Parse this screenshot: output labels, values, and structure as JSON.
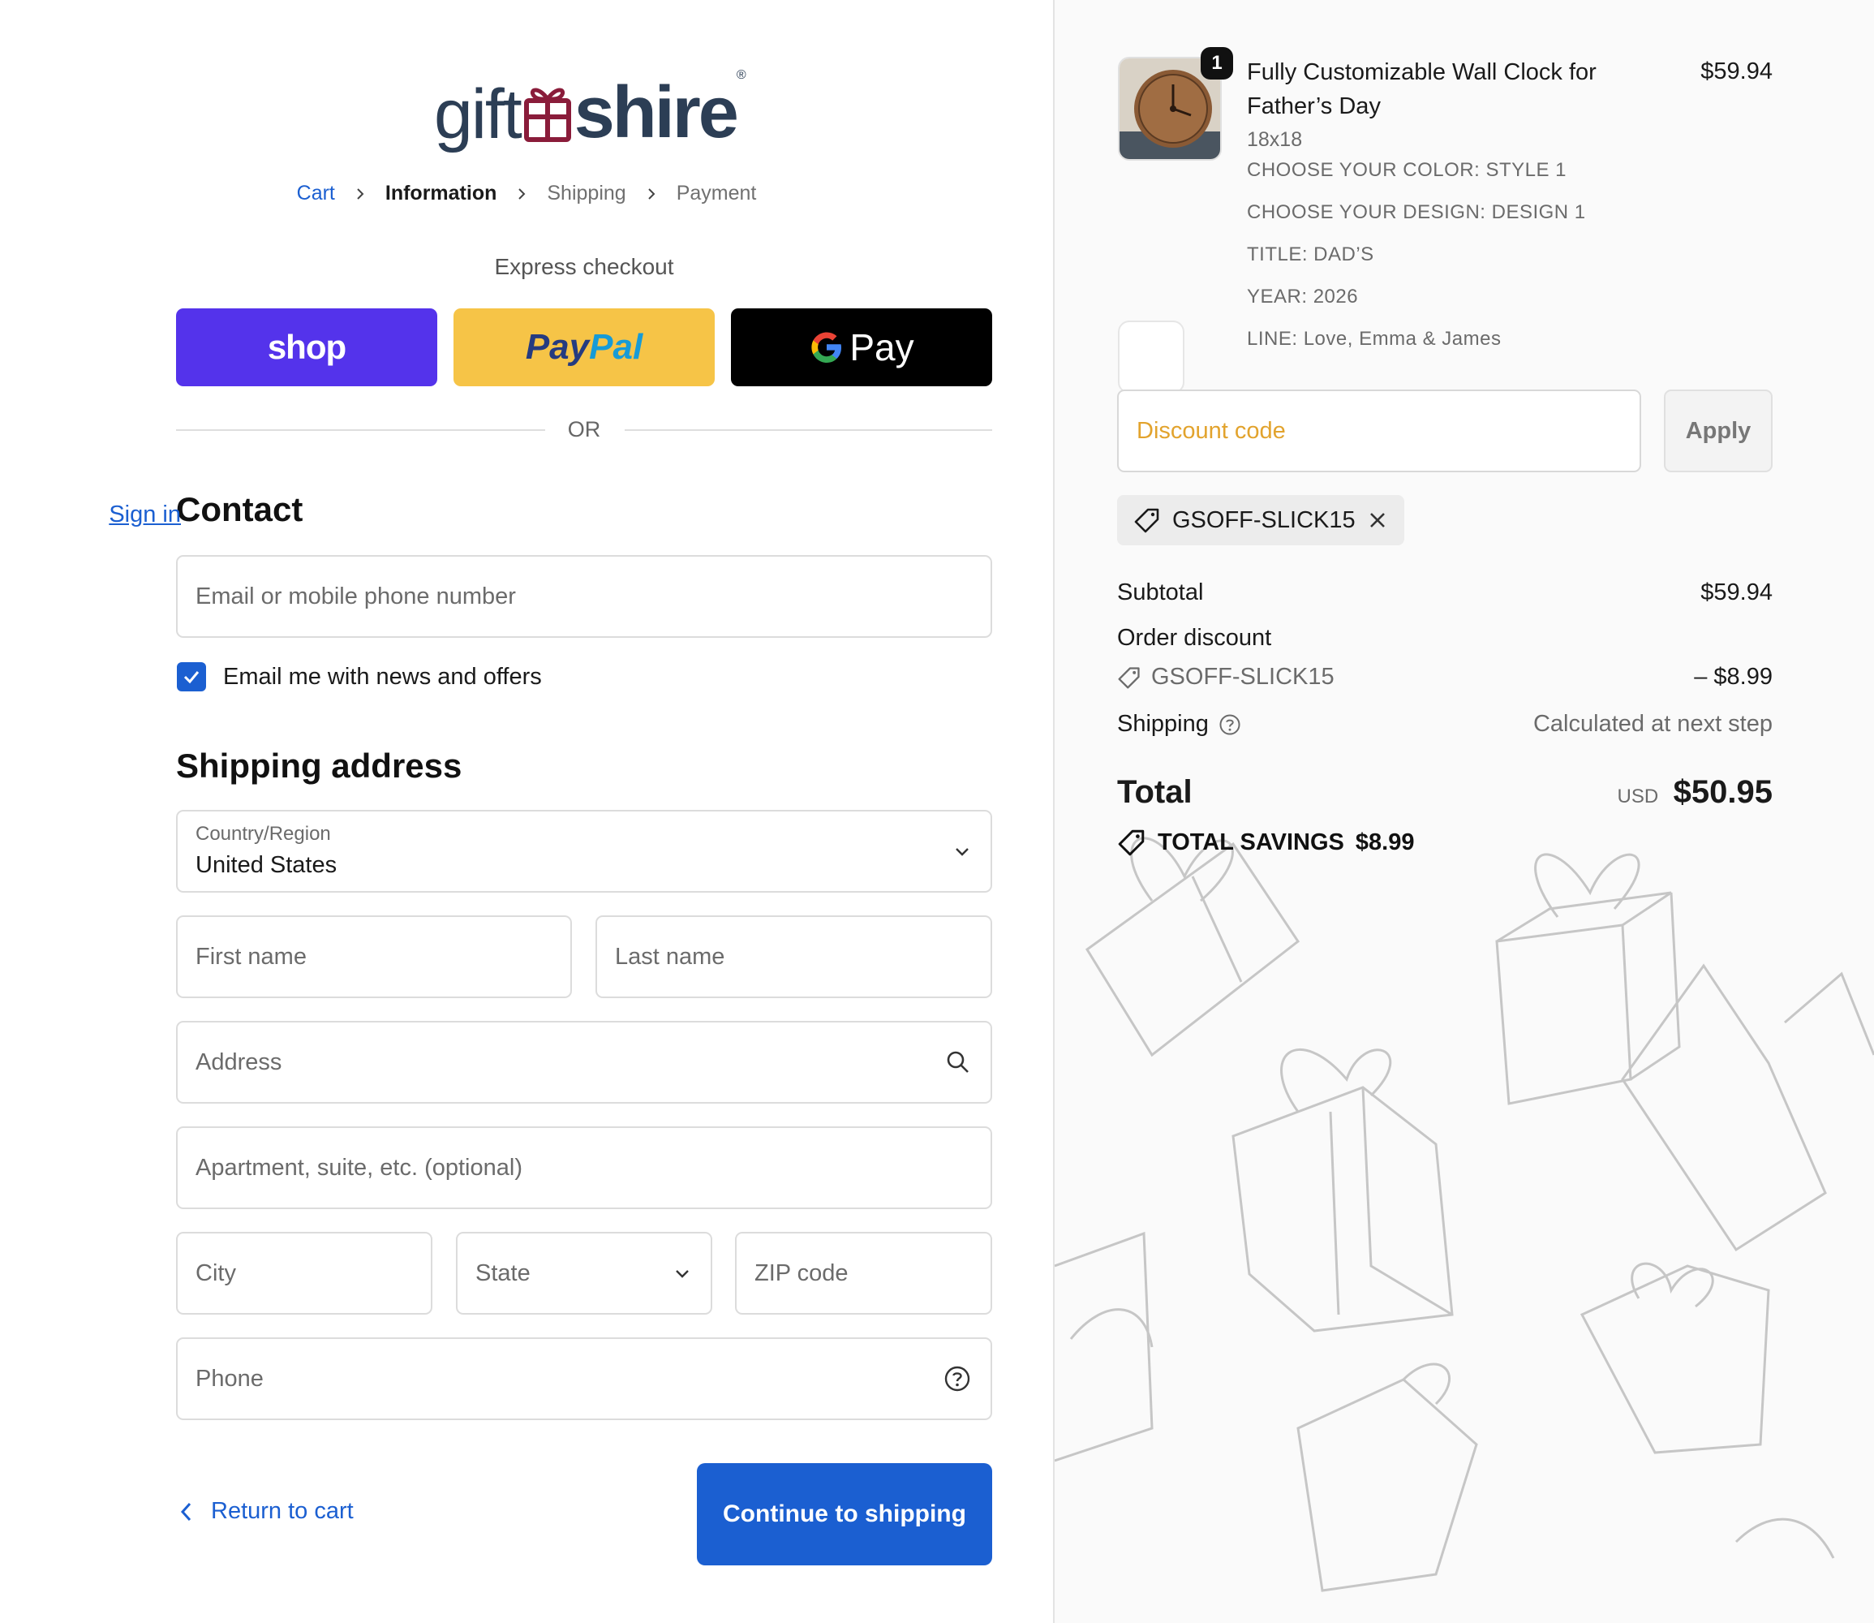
{
  "brand": {
    "logo_left": "gift",
    "logo_right": "shire",
    "registered": "®"
  },
  "breadcrumb": [
    {
      "label": "Cart"
    },
    {
      "label": "Information"
    },
    {
      "label": "Shipping"
    },
    {
      "label": "Payment"
    }
  ],
  "express": {
    "title": "Express checkout",
    "shop_label": "shop",
    "paypal_label_1": "Pay",
    "paypal_label_2": "Pal",
    "gpay_label": "Pay",
    "or_label": "OR"
  },
  "contact": {
    "title": "Contact",
    "signin_label": "Sign in",
    "email_placeholder": "Email or mobile phone number",
    "newsletter_label": "Email me with news and offers",
    "newsletter_checked": true
  },
  "shipping_address": {
    "title": "Shipping address",
    "country_label": "Country/Region",
    "country_value": "United States",
    "first_name_placeholder": "First name",
    "last_name_placeholder": "Last name",
    "address_placeholder": "Address",
    "apartment_placeholder": "Apartment, suite, etc. (optional)",
    "city_placeholder": "City",
    "state_placeholder": "State",
    "zip_placeholder": "ZIP code",
    "phone_placeholder": "Phone"
  },
  "actions": {
    "return_label": "Return to cart",
    "continue_label": "Continue to shipping"
  },
  "order": {
    "item": {
      "quantity": "1",
      "title": "Fully Customizable Wall Clock for Father’s Day",
      "price": "$59.94",
      "variant": "18x18",
      "options": [
        "CHOOSE YOUR COLOR: STYLE 1",
        "CHOOSE YOUR DESIGN: DESIGN 1",
        "TITLE: DAD’S",
        "YEAR: 2026",
        "LINE: Love, Emma & James"
      ]
    },
    "discount_placeholder": "Discount code",
    "apply_label": "Apply",
    "applied_code": "GSOFF-SLICK15",
    "subtotal_label": "Subtotal",
    "subtotal_value": "$59.94",
    "order_discount_label": "Order discount",
    "discount_code_line": "GSOFF-SLICK15",
    "discount_value": "– $8.99",
    "shipping_label": "Shipping",
    "shipping_value": "Calculated at next step",
    "total_label": "Total",
    "currency": "USD",
    "total_value": "$50.95",
    "savings_label": "TOTAL SAVINGS",
    "savings_value": "$8.99"
  },
  "colors": {
    "accent": "#1b5fd1",
    "shop": "#5433eb",
    "paypal": "#f6c447",
    "gpay": "#000000",
    "discount_placeholder": "#e2a32d"
  }
}
